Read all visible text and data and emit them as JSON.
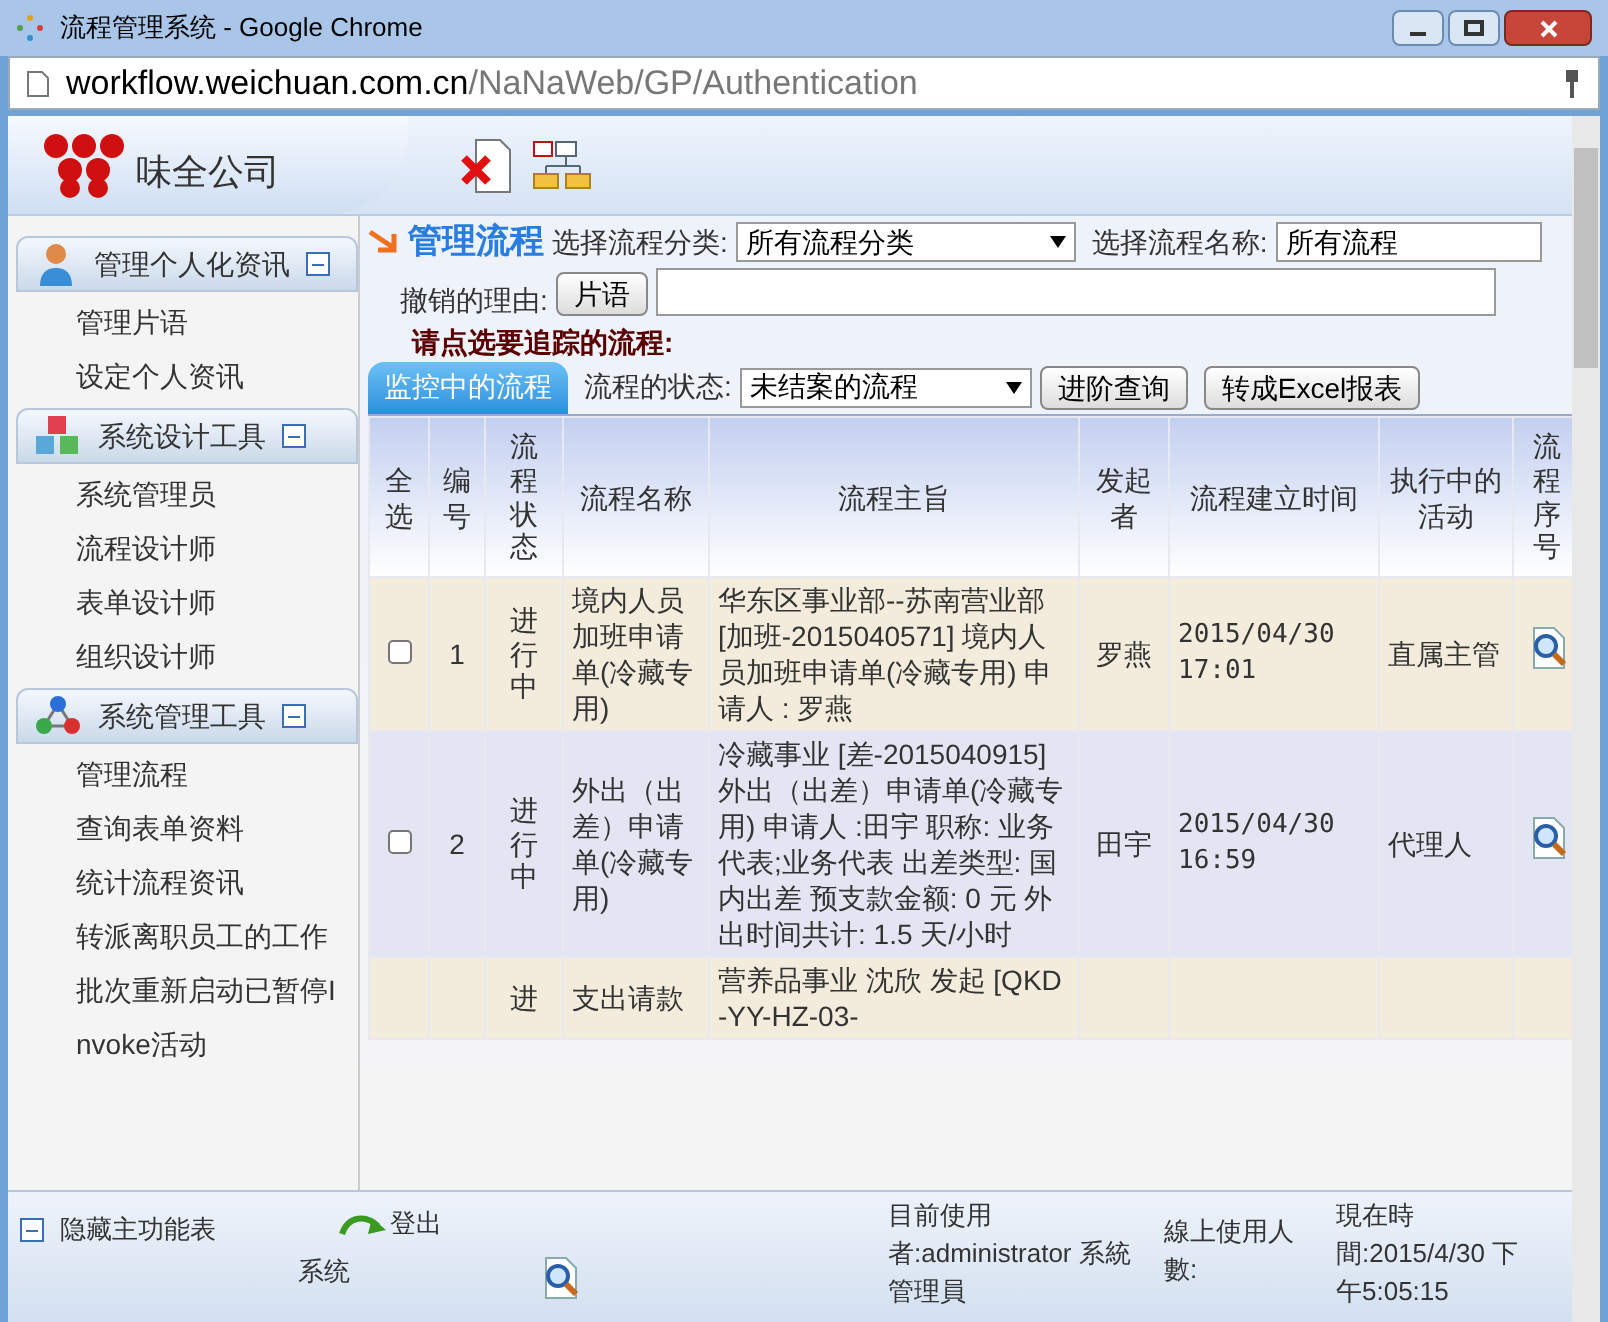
{
  "browser": {
    "tab_title": "流程管理系统 - Google Chrome",
    "url_host": "workflow.weichuan.com.cn",
    "url_path": "/NaNaWeb/GP/Authentication"
  },
  "header": {
    "company": "味全公司"
  },
  "sidebar": {
    "sections": [
      {
        "title": "管理个人化资讯",
        "kind": "person",
        "expanded": true,
        "items": [
          "管理片语",
          "设定个人资讯"
        ]
      },
      {
        "title": "系统设计工具",
        "kind": "cubes",
        "expanded": true,
        "items": [
          "系统管理员",
          "流程设计师",
          "表单设计师",
          "组织设计师"
        ]
      },
      {
        "title": "系统管理工具",
        "kind": "molecule",
        "expanded": true,
        "items": [
          "管理流程",
          "查询表单资料",
          "统计流程资讯",
          "转派离职员工的工作",
          "批次重新启动已暂停Invoke活动"
        ]
      }
    ]
  },
  "main": {
    "title": "管理流程",
    "category_label": "选择流程分类:",
    "category_value": "所有流程分类",
    "name_label": "选择流程名称:",
    "name_value": "所有流程",
    "reason_label": "撤销的理由:",
    "phrase_button": "片语",
    "prompt": "请点选要追踪的流程:",
    "tab": {
      "label": "监控中的流程",
      "selected": true
    },
    "state_label": "流程的状态:",
    "state_value": "未结案的流程",
    "advanced_button": "进阶查询",
    "excel_button": "转成Excel报表"
  },
  "table": {
    "columns": [
      "全选",
      "编号",
      "流程状态",
      "流程名称",
      "流程主旨",
      "发起者",
      "流程建立时间",
      "执行中的活动",
      "流程序号"
    ],
    "rows": [
      {
        "checked": false,
        "no": "1",
        "state": "进行中",
        "name": "境内人员加班申请单(冷藏专用)",
        "subject": "华东区事业部--苏南营业部 [加班-2015040571] 境内人员加班申请单(冷藏专用) 申请人 : 罗燕",
        "initiator": "罗燕",
        "created": "2015/04/30 17:01",
        "activity": "直属主管"
      },
      {
        "checked": false,
        "no": "2",
        "state": "进行中",
        "name": "外出（出差）申请单(冷藏专用)",
        "subject": "冷藏事业 [差-2015040915]外出（出差）申请单(冷藏专用) 申请人 :田宇 职称: 业务代表;业务代表 出差类型: 国内出差 预支款金额: 0 元 外出时间共计: 1.5 天/小时",
        "initiator": "田宇",
        "created": "2015/04/30 16:59",
        "activity": "代理人"
      },
      {
        "state": "进",
        "name": "支出请款",
        "subject": "营养品事业 沈欣 发起 [QKD-YY-HZ-03-"
      }
    ]
  },
  "footer": {
    "hide_label": "隐藏主功能表",
    "logout_label": "登出",
    "system_label": "系统",
    "current_user": "目前使用者:administrator 系統管理員",
    "online_users": "線上使用人數:",
    "now": "現在時間:2015/4/30 下午5:05:15"
  }
}
